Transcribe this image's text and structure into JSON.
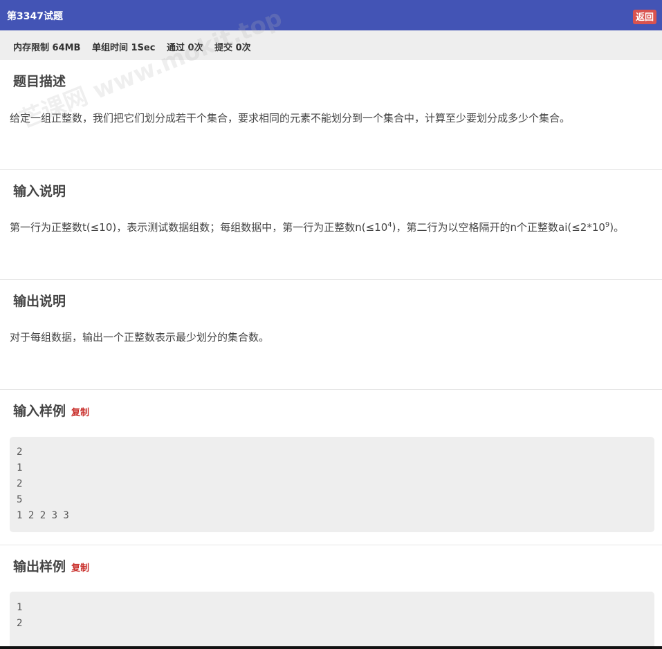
{
  "header": {
    "title": "第3347试题",
    "back_label": "返回"
  },
  "stats": {
    "memory": "内存限制 64MB",
    "time": "单组时间 1Sec",
    "passed": "通过 0次",
    "submitted": "提交 0次"
  },
  "watermark": "芒课网 www.mokit.top",
  "sections": {
    "description": {
      "heading": "题目描述",
      "text": "给定一组正整数，我们把它们划分成若干个集合，要求相同的元素不能划分到一个集合中，计算至少要划分成多少个集合。"
    },
    "input": {
      "heading": "输入说明",
      "part1": "第一行为正整数t(≤10)，表示测试数据组数；每组数据中，第一行为正整数n(≤10",
      "sup1": "4",
      "part2": ")，第二行为以空格隔开的n个正整数ai(≤2*10",
      "sup2": "9",
      "part3": ")。"
    },
    "output": {
      "heading": "输出说明",
      "text": "对于每组数据，输出一个正整数表示最少划分的集合数。"
    },
    "sample_input": {
      "heading": "输入样例",
      "copy_label": "复制",
      "lines": [
        "2",
        "1",
        "2",
        "5",
        "1 2 2 3 3"
      ]
    },
    "sample_output": {
      "heading": "输出样例",
      "copy_label": "复制",
      "lines": [
        "1",
        "2"
      ]
    }
  }
}
